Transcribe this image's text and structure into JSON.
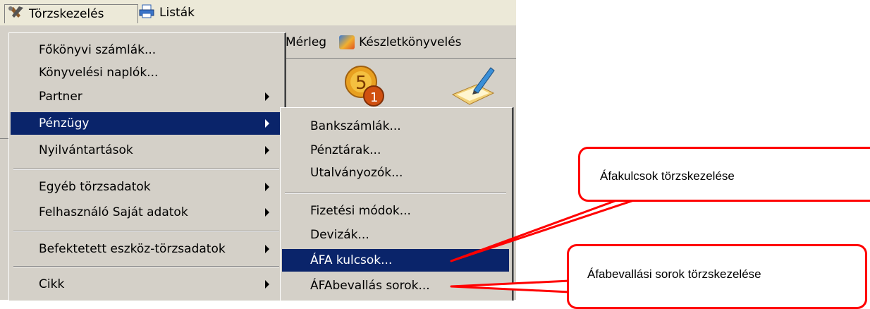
{
  "menubar": {
    "items": [
      {
        "label": "Törzskezelés",
        "icon": "tools-icon"
      },
      {
        "label": "Listák",
        "icon": "printer-icon"
      }
    ]
  },
  "toolbar": {
    "items": [
      {
        "label": "Mérleg"
      },
      {
        "label": "Készletkönyvelés",
        "icon": "boxes-icon"
      }
    ]
  },
  "main_menu": {
    "items": [
      {
        "label": "Főkönyvi számlák...",
        "submenu": false
      },
      {
        "label": "Könyvelési naplók...",
        "submenu": false
      },
      {
        "label": "Partner",
        "submenu": true
      },
      {
        "label": "Pénzügy",
        "submenu": true,
        "selected": true
      },
      {
        "label": "Nyilvántartások",
        "submenu": true
      },
      {
        "label": "Egyéb törzsadatok",
        "submenu": true
      },
      {
        "label": "Felhasználó Saját adatok",
        "submenu": true
      },
      {
        "label": "Befektetett eszköz-törzsadatok",
        "submenu": true
      },
      {
        "label": "Cikk",
        "submenu": true
      }
    ]
  },
  "sub_menu": {
    "items": [
      {
        "label": "Bankszámlák..."
      },
      {
        "label": "Pénztárak..."
      },
      {
        "label": "Utalványozók..."
      },
      {
        "label": "Fizetési módok..."
      },
      {
        "label": "Devizák..."
      },
      {
        "label": "ÁFA kulcsok...",
        "selected": true
      },
      {
        "label": "ÁFAbevallás sorok..."
      }
    ]
  },
  "callouts": [
    {
      "text": "Áfakulcsok törzskezelése"
    },
    {
      "text": "Áfabevallási sorok törzskezelése"
    }
  ],
  "colors": {
    "selection": "#0a246a",
    "menu_bg": "#d4d0c8",
    "callout_border": "#ff0000"
  }
}
